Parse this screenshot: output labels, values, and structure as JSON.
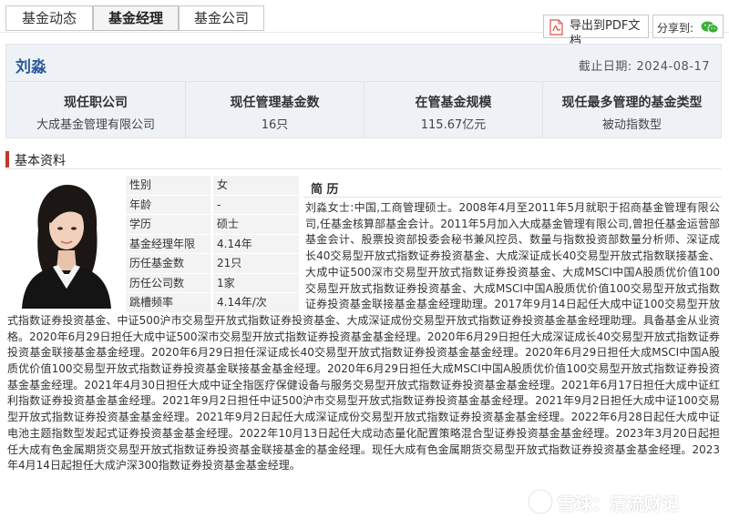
{
  "tabs": [
    {
      "label": "基金动态"
    },
    {
      "label": "基金经理",
      "active": true
    },
    {
      "label": "基金公司"
    }
  ],
  "toolbar": {
    "pdf_label": "导出到PDF文档",
    "share_label": "分享到:",
    "share_icon": "wechat-icon"
  },
  "manager": {
    "name": "刘淼",
    "date_label": "截止日期:",
    "date": "2024-08-17"
  },
  "stats": [
    {
      "label": "现任职公司",
      "value": "大成基金管理有限公司"
    },
    {
      "label": "现任管理基金数",
      "value": "16只"
    },
    {
      "label": "在管基金规模",
      "value": "115.67亿元"
    },
    {
      "label": "现任最多管理的基金类型",
      "value": "被动指数型"
    }
  ],
  "section": {
    "title": "基本资料",
    "accent_color": "#c0392b"
  },
  "profile": [
    {
      "key": "性别",
      "value": "女"
    },
    {
      "key": "年龄",
      "value": "-"
    },
    {
      "key": "学历",
      "value": "硕士"
    },
    {
      "key": "基金经理年限",
      "value": "4.14年"
    },
    {
      "key": "历任基金数",
      "value": "21只"
    },
    {
      "key": "历任公司数",
      "value": "1家"
    },
    {
      "key": "跳槽频率",
      "value": "4.14年/次"
    }
  ],
  "bio": {
    "heading": "简 历",
    "text": "刘淼女士:中国,工商管理硕士。2008年4月至2011年5月就职于招商基金管理有限公司,任基金核算部基金会计。2011年5月加入大成基金管理有限公司,曾担任基金运营部基金会计、股票投资部投委会秘书兼风控员、数量与指数投资部数量分析师、深证成长40交易型开放式指数证券投资基金、大成深证成长40交易型开放式指数联接基金、大成中证500深市交易型开放式指数证券投资基金、大成MSCI中国A股质优价值100交易型开放式指数证券投资基金、大成MSCI中国A股质优价值100交易型开放式指数证券投资基金联接基金基金经理助理。2017年9月14日起任大成中证100交易型开放式指数证券投资基金、中证500沪市交易型开放式指数证券投资基金、大成深证成份交易型开放式指数证券投资基金基金经理助理。具备基金从业资格。2020年6月29日担任大成中证500深市交易型开放式指数证券投资基金基金经理。2020年6月29日担任大成深证成长40交易型开放式指数证券投资基金联接基金基金经理。2020年6月29日担任深证成长40交易型开放式指数证券投资基金基金经理。2020年6月29日担任大成MSCI中国A股质优价值100交易型开放式指数证券投资基金联接基金基金经理。2020年6月29日担任大成MSCI中国A股质优价值100交易型开放式指数证券投资基金基金经理。2021年4月30日担任大成中证全指医疗保健设备与服务交易型开放式指数证券投资基金基金经理。2021年6月17日担任大成中证红利指数证券投资基金基金经理。2021年9月2日担任中证500沪市交易型开放式指数证券投资基金基金经理。2021年9月2日担任大成中证100交易型开放式指数证券投资基金基金经理。2021年9月2日起任大成深证成份交易型开放式指数证券投资基金基金经理。2022年6月28日起任大成中证电池主题指数型发起式证券投资基金基金经理。2022年10月13日起任大成动态量化配置策略混合型证券投资基金基金经理。2023年3月20日起担任大成有色金属期货交易型开放式指数证券投资基金联接基金的基金经理。现任大成有色金属期货交易型开放式指数证券投资基金基金经理。2023年4月14日起担任大成沪深300指数证券投资基金基金经理。"
  },
  "watermark": {
    "text": "雪球：清流财记"
  }
}
